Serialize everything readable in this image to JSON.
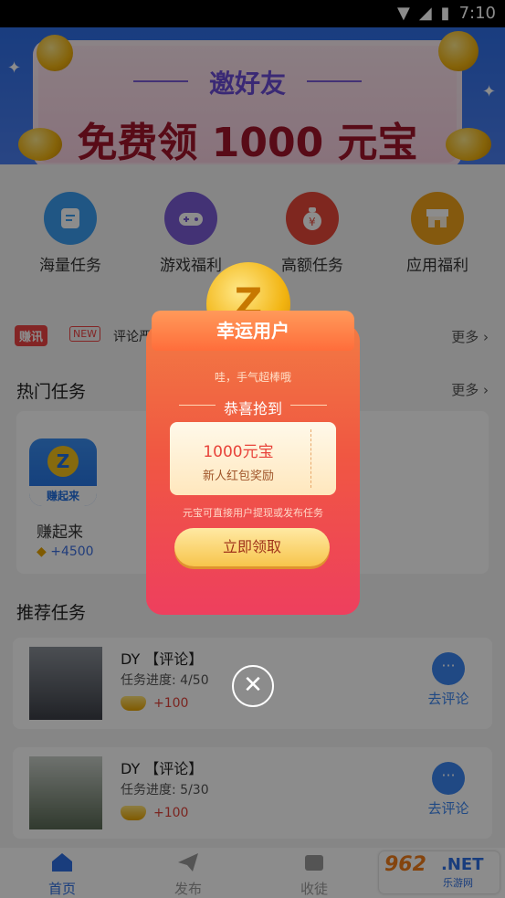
{
  "status_bar": {
    "time": "7:10",
    "wifi_icon": "wifi-icon",
    "signal_icon": "signal-icon",
    "battery_icon": "battery-icon"
  },
  "banner": {
    "title": "邀好友",
    "subtitle": "免费领 1000 元宝"
  },
  "quick_actions": [
    {
      "label": "海量任务",
      "icon": "document-icon",
      "color": "#3b9df0"
    },
    {
      "label": "游戏福利",
      "icon": "gamepad-icon",
      "color": "#7b5bd6"
    },
    {
      "label": "高额任务",
      "icon": "moneybag-icon",
      "color": "#e8473a"
    },
    {
      "label": "应用福利",
      "icon": "shop-icon",
      "color": "#f0a21a"
    }
  ],
  "notice": {
    "badge": "赚讯",
    "new_badge": "NEW",
    "text": "评论严禁",
    "more": "更多"
  },
  "hot_tasks": {
    "title": "热门任务",
    "more": "更多",
    "items": [
      {
        "name": "赚起来",
        "reward": "+4500",
        "icon_label": "赚起来"
      }
    ]
  },
  "recommended": {
    "title": "推荐任务",
    "items": [
      {
        "title": "DY 【评论】",
        "progress": "任务进度: 4/50",
        "reward": "+100",
        "action": "去评论"
      },
      {
        "title": "DY 【评论】",
        "progress": "任务进度: 5/30",
        "reward": "+100",
        "action": "去评论"
      }
    ]
  },
  "tabbar": {
    "items": [
      {
        "label": "首页",
        "icon": "home-icon",
        "active": true
      },
      {
        "label": "发布",
        "icon": "send-icon",
        "active": false
      },
      {
        "label": "收徒",
        "icon": "inbox-icon",
        "active": false
      }
    ]
  },
  "watermark": {
    "number": "962",
    "net": ".NET",
    "sub": "乐游网"
  },
  "popup": {
    "ribbon": "幸运用户",
    "coin_letter": "Z",
    "cheer": "哇，手气超棒哦",
    "congrats": "恭喜抢到",
    "amount": "1000元宝",
    "desc": "新人红包奖励",
    "note": "元宝可直接用户提现或发布任务",
    "button": "立即领取",
    "close": "✕"
  }
}
